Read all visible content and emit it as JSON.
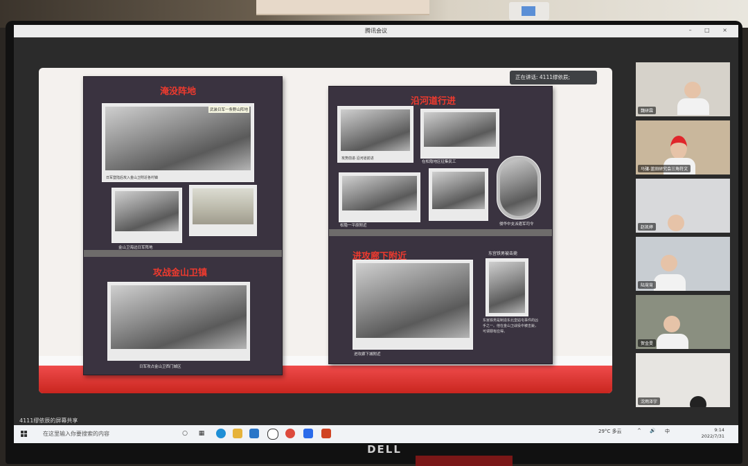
{
  "window": {
    "title": "腾讯会议",
    "controls": "– □ ×"
  },
  "speaker_tag": "正在讲话: 4111缪依辰;",
  "screen_share_label": "4111缪依辰的屏幕共享",
  "left_panel": {
    "title_top": "淹没阵地",
    "photo1_caption": "日军登陆后攻入金山卫附近各村镇",
    "photo1_tag": "武装日军一条野山阵地",
    "photo2_caption": "金山卫海边日军阵地",
    "title_bottom": "攻战金山卫镇",
    "photo4_caption": "日军攻占金山卫西门城区"
  },
  "right_panel": {
    "title_top": "沿河道行进",
    "captions": [
      "攻势前进·沿河道前进",
      "在松隐地区征集民工",
      "松隐一平原附近",
      "",
      "侵华中支派遣军司令"
    ],
    "title_bottom": "进攻廊下附近",
    "bottom_caption": "进攻廊下城附近",
    "portrait_title": "东宫铁男被击毙",
    "notes": "东宫铁男是制造东北皇姑屯事件的凶手之一。他在金山卫战役中被击毙，可谓罪有应得。"
  },
  "participants": [
    {
      "name": "魏研霖",
      "bg": "#d6d2ca"
    },
    {
      "name": "马骧-蓝田研究会三角符文",
      "bg": "#c9b79c"
    },
    {
      "name": "赵凯婷",
      "bg": "#d8d9db"
    },
    {
      "name": "陆霓霓",
      "bg": "#c8cdd2"
    },
    {
      "name": "贺金旻",
      "bg": "#8a8f80"
    },
    {
      "name": "沈雨泽宇",
      "bg": "#e7e5e1"
    }
  ],
  "taskbar": {
    "search_placeholder": "在这里输入你要搜索的内容",
    "weather": "29°C 多云",
    "ime": "中",
    "time": "9:14",
    "date": "2022/7/31"
  },
  "brand": "DELL",
  "colors": {
    "accent_red": "#ef3a2e",
    "panel_bg": "#3a3340"
  }
}
